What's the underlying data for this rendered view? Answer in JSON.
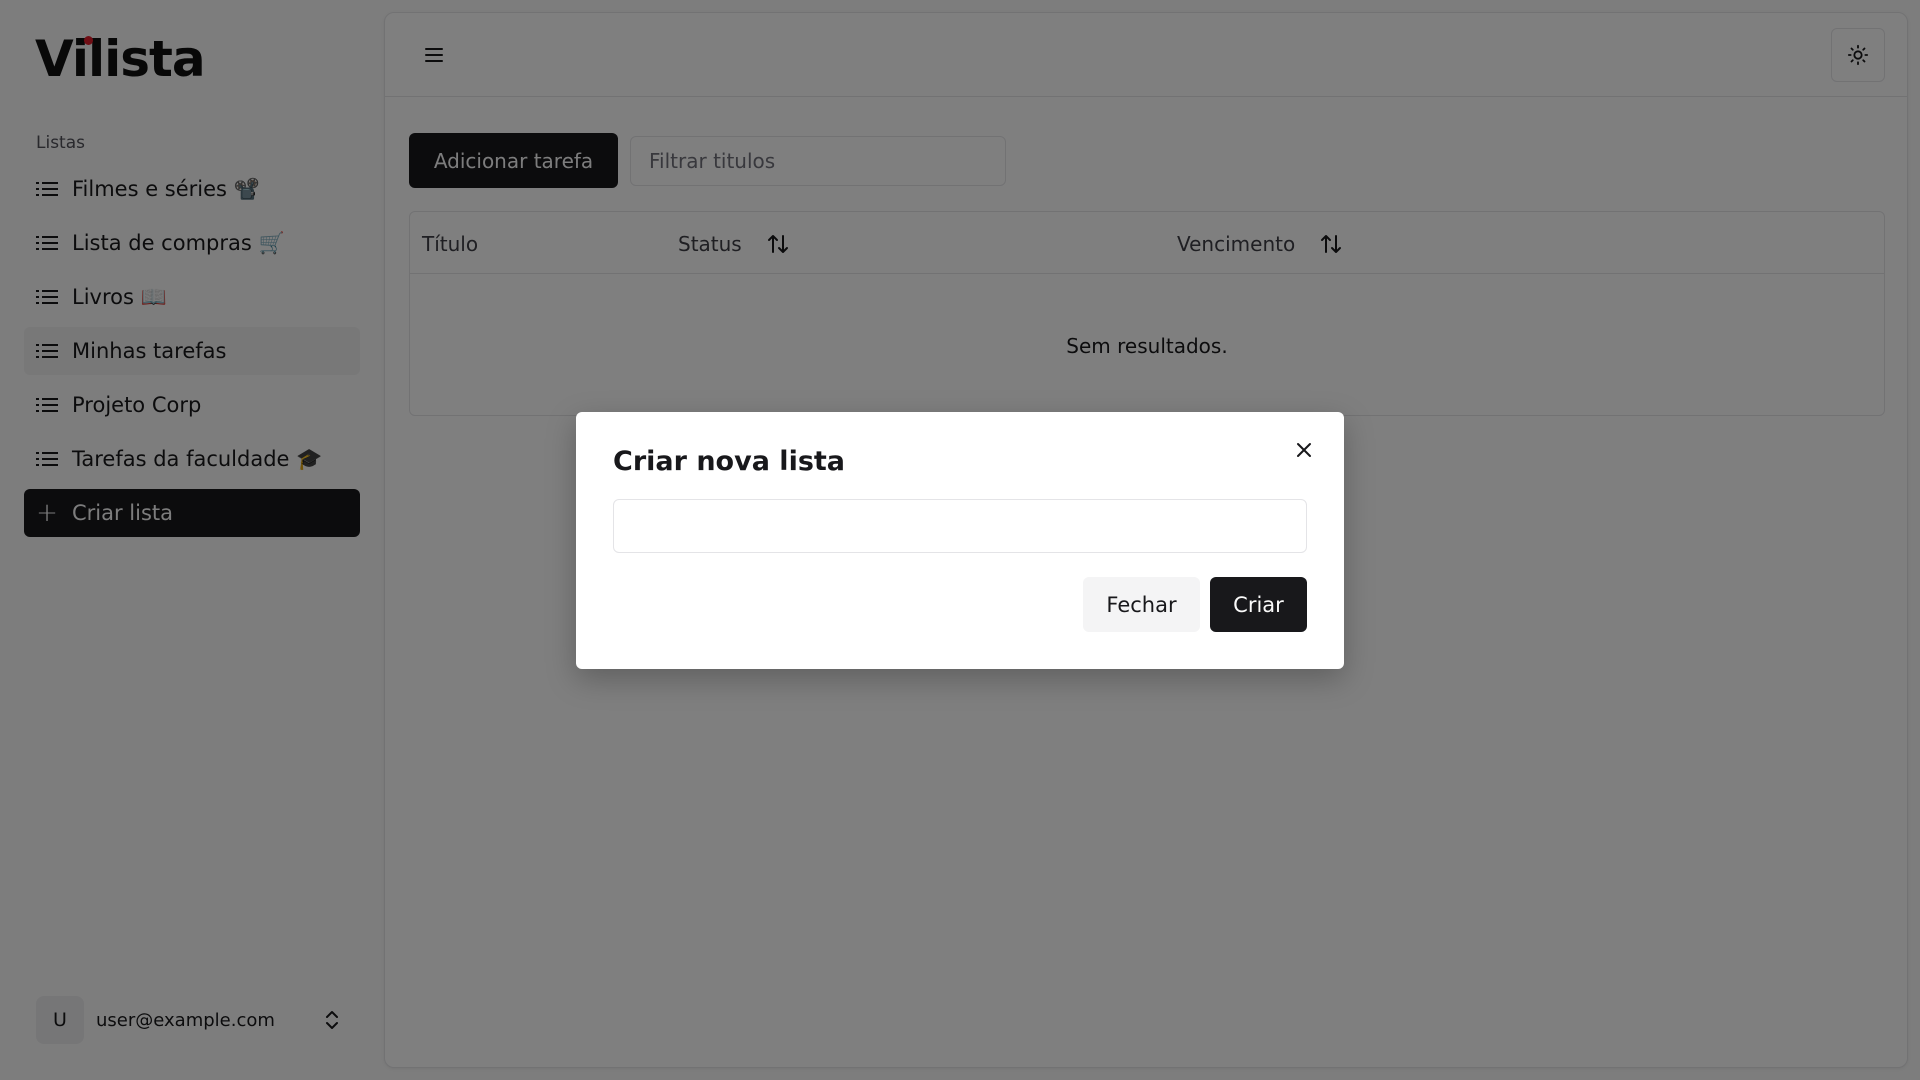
{
  "app": {
    "logo": "Vilista"
  },
  "sidebar": {
    "section_label": "Listas",
    "items": [
      {
        "label": "Filmes e séries 📽️",
        "icon": "list-icon",
        "active": false
      },
      {
        "label": "Lista de compras 🛒",
        "icon": "list-icon",
        "active": false
      },
      {
        "label": "Livros 📖",
        "icon": "list-icon",
        "active": false
      },
      {
        "label": "Minhas tarefas",
        "icon": "list-icon",
        "active": true
      },
      {
        "label": "Projeto Corp",
        "icon": "list-icon",
        "active": false
      },
      {
        "label": "Tarefas da faculdade 🎓",
        "icon": "list-icon",
        "active": false
      }
    ],
    "create_label": "Criar lista",
    "user": {
      "avatar_initial": "U",
      "email": "user@example.com"
    }
  },
  "toolbar": {
    "add_task_label": "Adicionar tarefa",
    "filter_placeholder": "Filtrar titulos"
  },
  "table": {
    "columns": [
      "Título",
      "Status",
      "Vencimento"
    ],
    "empty_message": "Sem resultados."
  },
  "modal": {
    "title": "Criar nova lista",
    "input_value": "",
    "close_label": "Fechar",
    "create_label": "Criar"
  },
  "colors": {
    "primary": "#18181b",
    "logo_dot": "#e11d2a",
    "overlay": "rgba(0,0,0,0.5)"
  }
}
